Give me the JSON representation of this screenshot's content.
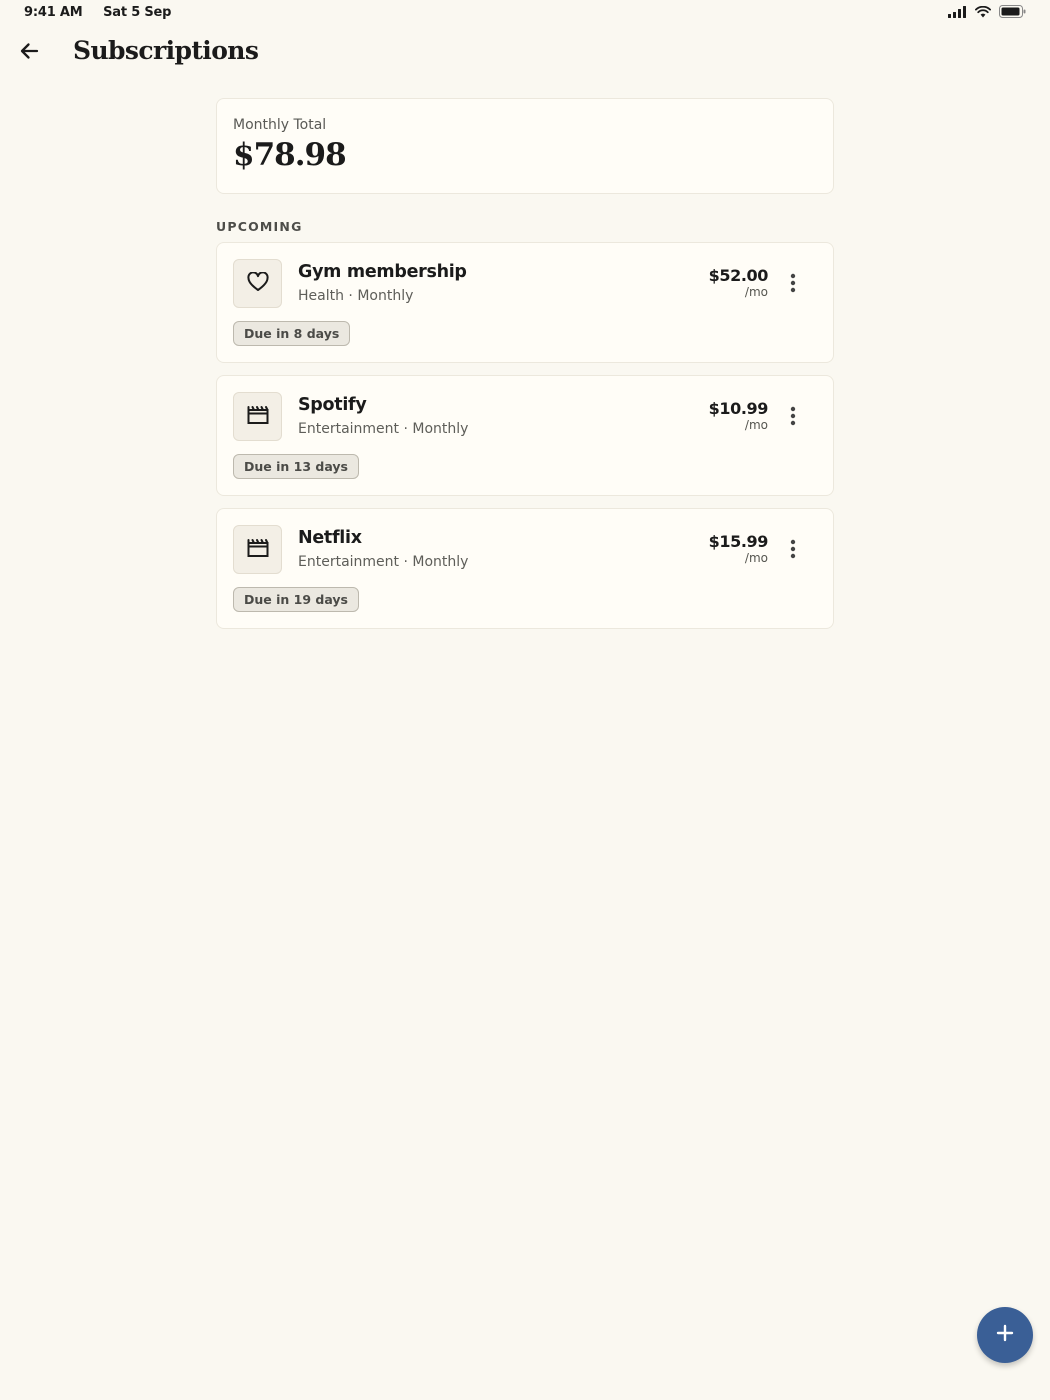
{
  "status_bar": {
    "time": "9:41 AM",
    "date": "Sat 5 Sep",
    "icons": [
      "signal-icon",
      "wifi-icon",
      "battery-icon"
    ]
  },
  "app_bar": {
    "back_icon": "arrow-left-icon",
    "title": "Subscriptions"
  },
  "summary": {
    "label": "Monthly Total",
    "value": "$78.98"
  },
  "section": {
    "heading": "UPCOMING"
  },
  "subscriptions": [
    {
      "name": "Gym membership",
      "category": "Health",
      "cycle": "Monthly",
      "amount": "$52.00",
      "period": "/mo",
      "due": "Due in 8 days",
      "icon": "heart-icon"
    },
    {
      "name": "Spotify",
      "category": "Entertainment",
      "cycle": "Monthly",
      "amount": "$10.99",
      "period": "/mo",
      "due": "Due in 13 days",
      "icon": "clapperboard-icon"
    },
    {
      "name": "Netflix",
      "category": "Entertainment",
      "cycle": "Monthly",
      "amount": "$15.99",
      "period": "/mo",
      "due": "Due in 19 days",
      "icon": "clapperboard-icon"
    }
  ],
  "meta_separator": " · ",
  "fab": {
    "icon": "plus-icon"
  },
  "colors": {
    "background": "#faf8f1",
    "card": "#fffdf7",
    "fab": "#3a5f96"
  }
}
